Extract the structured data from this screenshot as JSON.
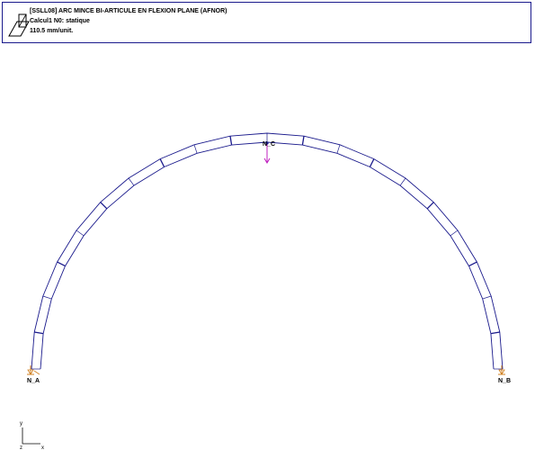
{
  "header": {
    "line1": "[SSLL08] ARC MINCE BI-ARTICULE EN FLEXION PLANE (AFNOR)",
    "line2": "Calcul1  N0: statique",
    "line3": "110.5 mm/unit."
  },
  "model": {
    "nodes": [
      {
        "id": "node-a",
        "label": "N_A"
      },
      {
        "id": "node-b",
        "label": "N_B"
      },
      {
        "id": "node-c",
        "label": "N_C"
      }
    ],
    "load": {
      "node": "N_C",
      "direction": "down",
      "color": "#c020c0"
    },
    "supports_color": "#d08020",
    "element_color": "#1a1a8c",
    "element_count": 20
  },
  "axes": {
    "y": "y",
    "z": "z",
    "x": "x"
  }
}
